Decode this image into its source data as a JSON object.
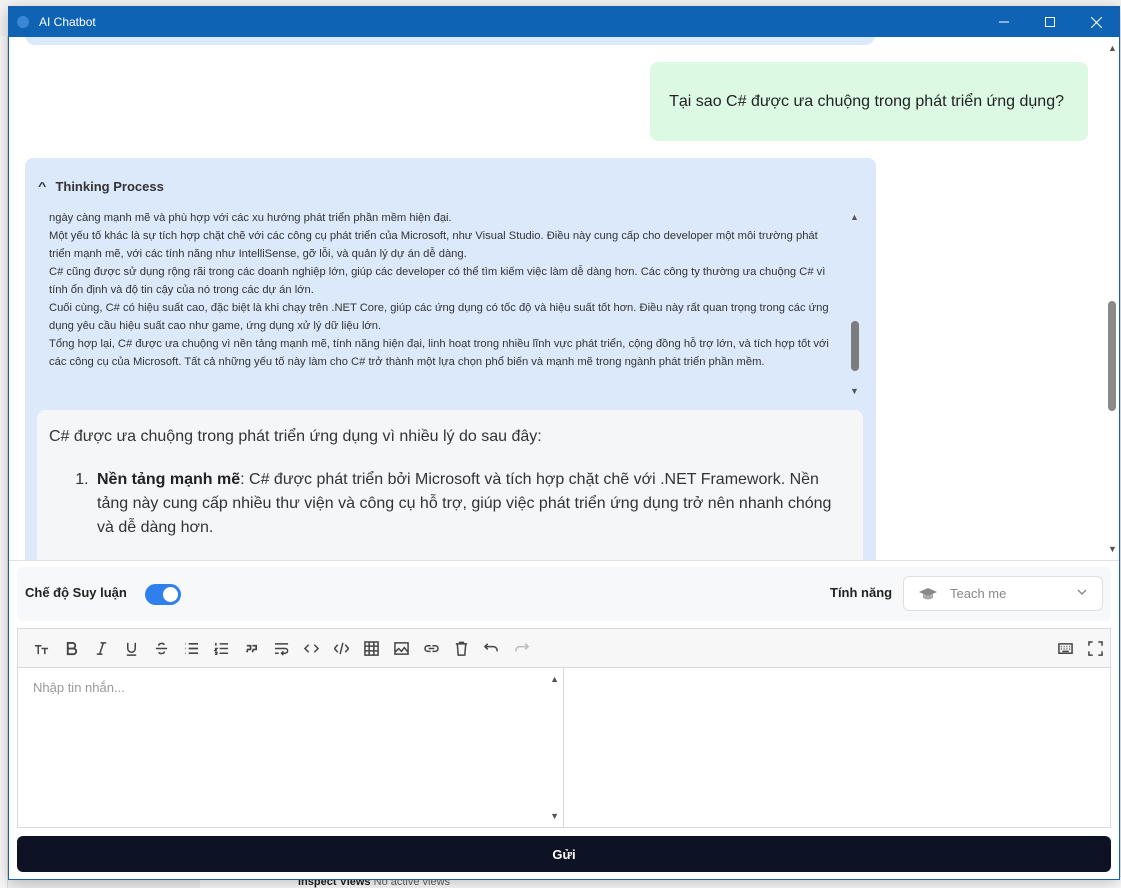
{
  "window": {
    "title": "AI Chatbot",
    "minimize": "—",
    "maximize": "□",
    "close": "✕"
  },
  "chat": {
    "user_message": "Tại sao C# được ưa chuộng trong phát triển ứng dụng?",
    "thinking": {
      "header": "Thinking Process",
      "lines": [
        "ngày càng mạnh mẽ và phù hợp với các xu hướng phát triển phần mềm hiện đại.",
        "Một yếu tố khác là sự tích hợp chặt chẽ với các công cụ phát triển của Microsoft, như Visual Studio. Điều này cung cấp cho developer một môi trường phát triển mạnh mẽ, với các tính năng như IntelliSense, gỡ lỗi, và quản lý dự án dễ dàng.",
        "C# cũng được sử dụng rộng rãi trong các doanh nghiệp lớn, giúp các developer có thể tìm kiếm việc làm dễ dàng hơn. Các công ty thường ưa chuộng C# vì tính ổn định và độ tin cậy của nó trong các dự án lớn.",
        "Cuối cùng, C# có hiệu suất cao, đặc biệt là khi chạy trên .NET Core, giúp các ứng dụng có tốc độ và hiệu suất tốt hơn. Điều này rất quan trọng trong các ứng dụng yêu cầu hiệu suất cao như game, ứng dụng xử lý dữ liệu lớn.",
        "Tổng hợp lại, C# được ưa chuộng vì nền tảng mạnh mẽ, tính năng hiện đại, linh hoạt trong nhiều lĩnh vực phát triển, cộng đồng hỗ trợ lớn, và tích hợp tốt với các công cụ của Microsoft. Tất cả những yếu tố này làm cho C# trở thành một lựa chọn phổ biến và mạnh mẽ trong ngành phát triển phần mềm."
      ]
    },
    "answer": {
      "intro": "C# được ưa chuộng trong phát triển ứng dụng vì nhiều lý do sau đây:",
      "items": [
        {
          "number": "1.",
          "title": "Nền tảng mạnh mẽ",
          "text": ": C# được phát triển bởi Microsoft và tích hợp chặt chẽ với .NET Framework. Nền tảng này cung cấp nhiều thư viện và công cụ hỗ trợ, giúp việc phát triển ứng dụng trở nên nhanh chóng và dễ dàng hơn."
        }
      ]
    }
  },
  "settings": {
    "reasoning_label": "Chế độ Suy luận",
    "reasoning_enabled": true,
    "feature_label": "Tính năng",
    "feature_value": "Teach me"
  },
  "editor": {
    "placeholder": "Nhập tin nhắn..."
  },
  "send_label": "Gửi",
  "background": {
    "inspect_label": "Inspect Views",
    "inspect_value": "No active views"
  },
  "colors": {
    "titlebar": "#0f63b5",
    "assistant_bg": "#dbe9fb",
    "user_bg": "#dcfae3",
    "toggle": "#2f80ed",
    "send_bg": "#0d1324"
  }
}
